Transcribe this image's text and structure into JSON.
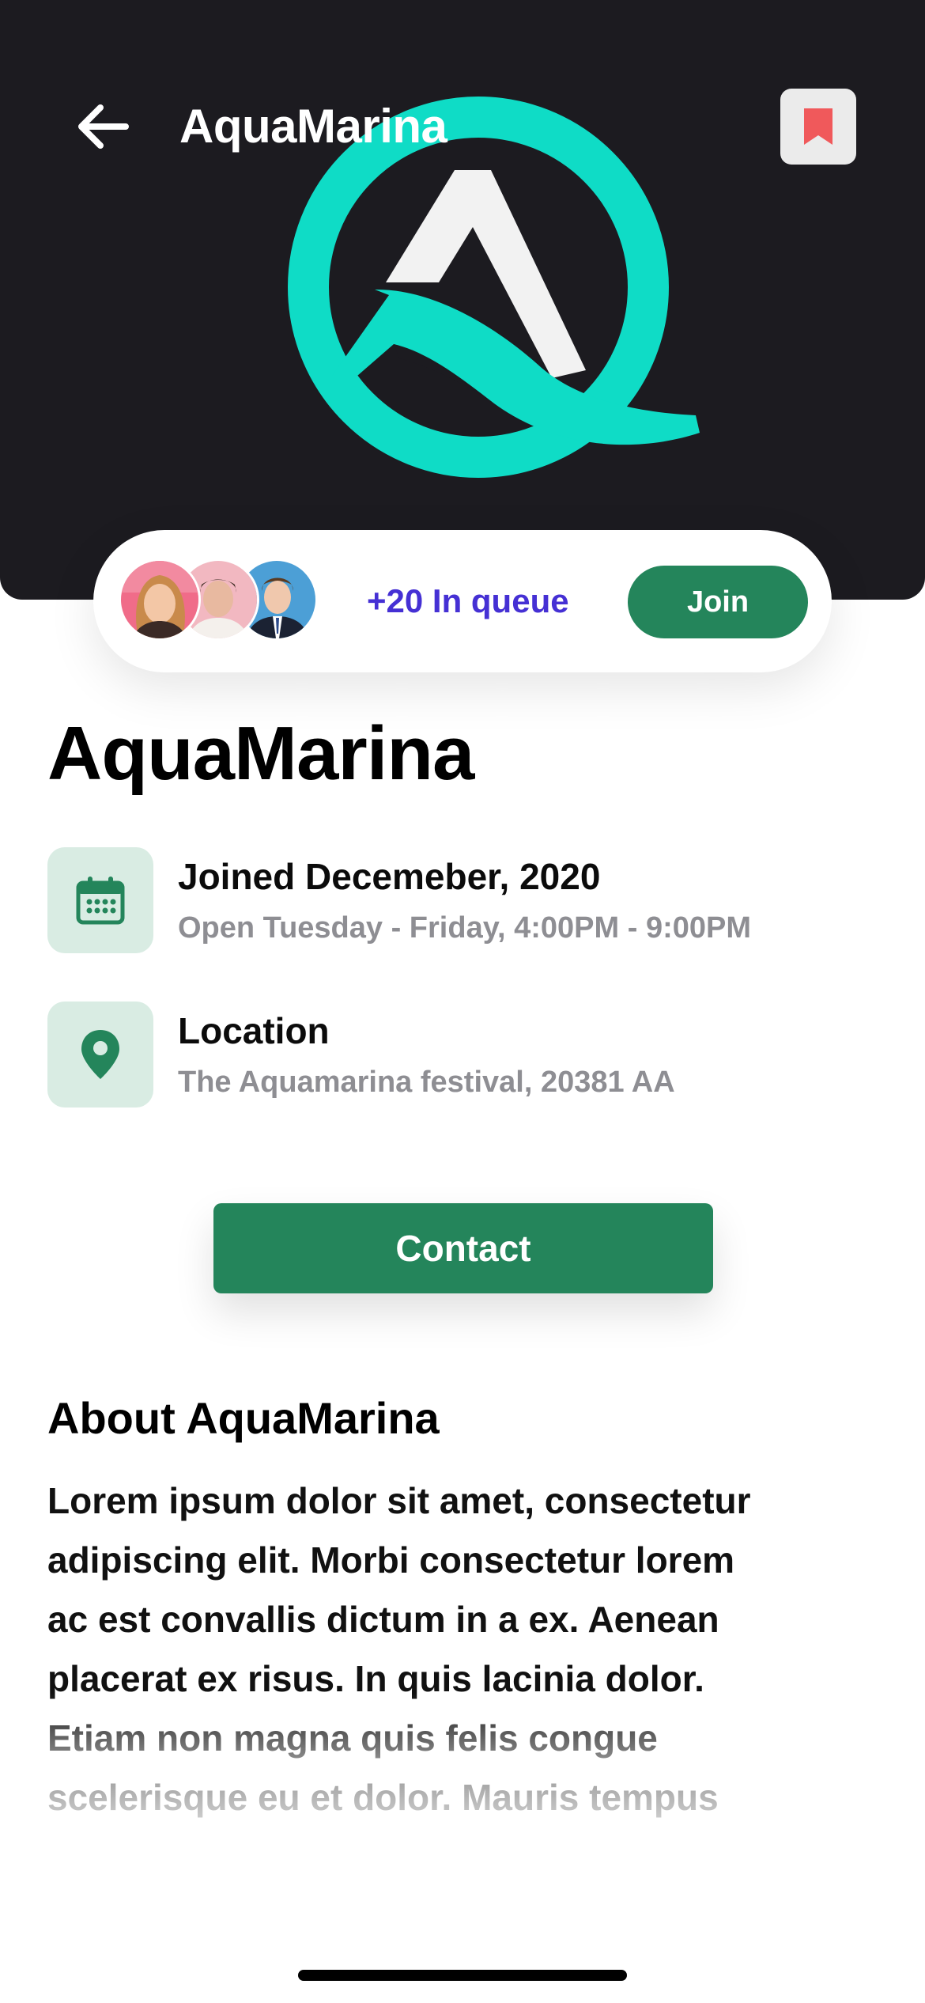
{
  "header": {
    "title": "AquaMarina",
    "back_icon": "arrow-left-icon",
    "bookmark_icon": "bookmark-icon"
  },
  "hero": {
    "logo": "aquamarina-logo"
  },
  "queue": {
    "count_text": "+20 In queue",
    "join_label": "Join",
    "avatars": [
      "avatar-woman",
      "avatar-man-pink",
      "avatar-man-suit"
    ]
  },
  "profile": {
    "name": "AquaMarina",
    "joined": "Joined Decemeber, 2020",
    "hours": "Open Tuesday - Friday, 4:00PM - 9:00PM",
    "location_label": "Location",
    "location_value": "The Aquamarina festival, 20381 AA"
  },
  "actions": {
    "contact_label": "Contact"
  },
  "about": {
    "heading": "About AquaMarina",
    "lines": [
      "Lorem ipsum dolor sit amet, consectetur",
      "adipiscing elit. Morbi consectetur lorem",
      "ac est convallis dictum in a ex. Aenean",
      "placerat ex risus. In quis lacinia dolor.",
      "Etiam non magna quis felis congue",
      "scelerisque eu et dolor. Mauris tempus"
    ]
  },
  "colors": {
    "accent_green": "#24855b",
    "queue_text": "#4530d4",
    "logo_teal": "#0fdcc6",
    "bookmark_red": "#f0595b",
    "hero_bg": "#1c1b20",
    "icon_box_bg": "#d9ece3"
  }
}
